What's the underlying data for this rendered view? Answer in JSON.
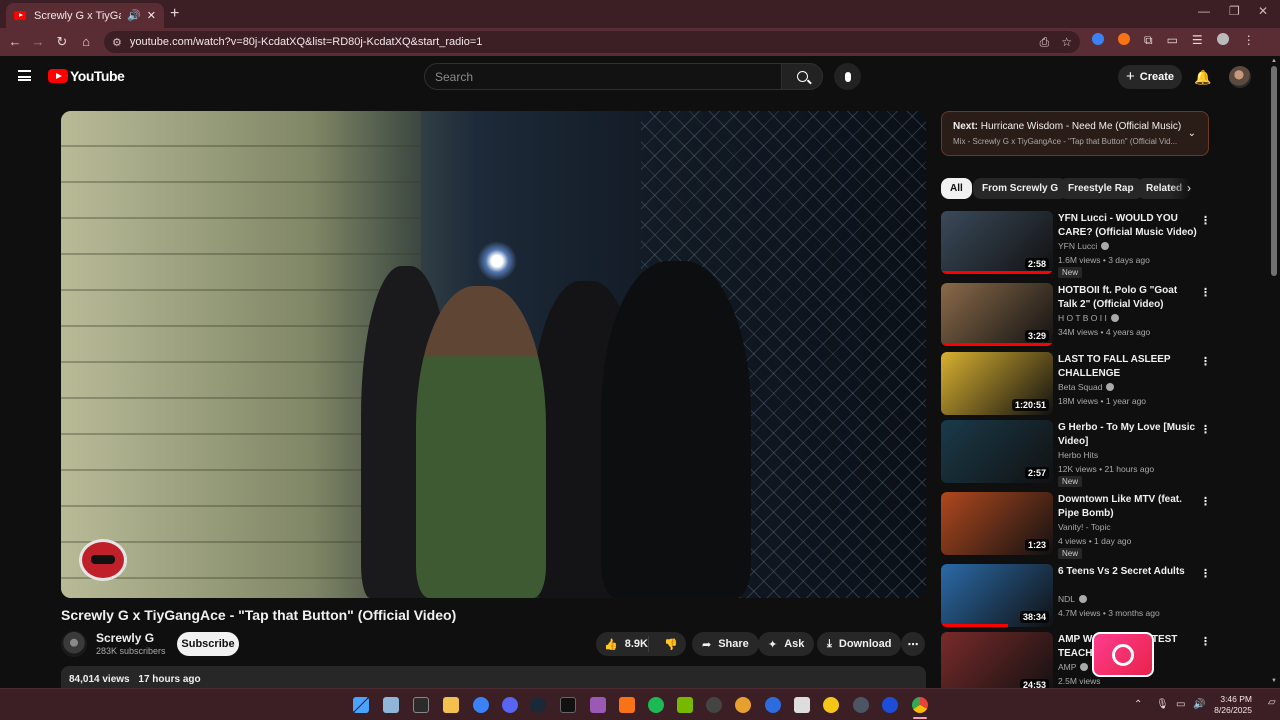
{
  "browser": {
    "tab_title": "Screwly G x TiyGangAce - \"Tap that Button\" (Official Video)",
    "url": "youtube.com/watch?v=80j-KcdatXQ&list=RD80j-KcdatXQ&start_radio=1",
    "accent": "#5a2d35"
  },
  "masthead": {
    "logo_text": "YouTube",
    "search_placeholder": "Search",
    "create_label": "Create"
  },
  "video": {
    "title": "Screwly G x TiyGangAce - \"Tap that Button\" (Official Video)",
    "channel": "Screwly G",
    "subscribers": "283K subscribers",
    "subscribe_label": "Subscribe",
    "likes": "8.9K",
    "share_label": "Share",
    "ask_label": "Ask",
    "download_label": "Download",
    "views": "84,014 views",
    "uploaded": "17 hours ago"
  },
  "next": {
    "label": "Next:",
    "title": "Hurricane Wisdom - Need Me (Official Music)",
    "subtitle": "Mix - Screwly G x TiyGangAce - \"Tap that Button\" (Official Vid..."
  },
  "chips": [
    "All",
    "From Screwly G",
    "Freestyle Rap",
    "Related"
  ],
  "recommendations": [
    {
      "title": "YFN Lucci - WOULD YOU CARE? (Official Music Video)",
      "channel": "YFN Lucci",
      "verified": true,
      "meta": "1.6M views • 3 days ago",
      "duration": "2:58",
      "badge": "New",
      "progress": 1.0,
      "thumb_color": "#3a4a5a"
    },
    {
      "title": "HOTBOII ft. Polo G \"Goat Talk 2\" (Official Video)",
      "channel": "H O T B O I I",
      "verified": true,
      "meta": "34M views • 4 years ago",
      "duration": "3:29",
      "badge": "",
      "progress": 1.0,
      "thumb_color": "#8a6a4a"
    },
    {
      "title": "LAST TO FALL ASLEEP CHALLENGE",
      "channel": "Beta Squad",
      "verified": true,
      "meta": "18M views • 1 year ago",
      "duration": "1:20:51",
      "badge": "",
      "progress": 0,
      "thumb_color": "#d8b030"
    },
    {
      "title": "G Herbo - To My Love [Music Video]",
      "channel": "Herbo Hits",
      "verified": false,
      "meta": "12K views • 21 hours ago",
      "duration": "2:57",
      "badge": "New",
      "progress": 0,
      "thumb_color": "#1a3a4a"
    },
    {
      "title": "Downtown Like MTV (feat. Pipe Bomb)",
      "channel": "Vanity! - Topic",
      "verified": false,
      "meta": "4 views • 1 day ago",
      "duration": "1:23",
      "badge": "New",
      "progress": 0,
      "thumb_color": "#b0481e"
    },
    {
      "title": "6 Teens Vs 2 Secret Adults",
      "channel": "NDL",
      "verified": true,
      "meta": "4.7M views • 3 months ago",
      "duration": "38:34",
      "badge": "",
      "progress": 0.6,
      "thumb_color": "#2a6aa8"
    },
    {
      "title": "AMP WORLD'S FASTEST TEACHER IRL",
      "channel": "AMP",
      "verified": true,
      "meta": "2.5M views",
      "duration": "24:53",
      "badge": "",
      "progress": 0,
      "thumb_color": "#7a2a2a"
    }
  ],
  "taskbar": {
    "time": "3:46 PM",
    "date": "8/26/2025"
  }
}
